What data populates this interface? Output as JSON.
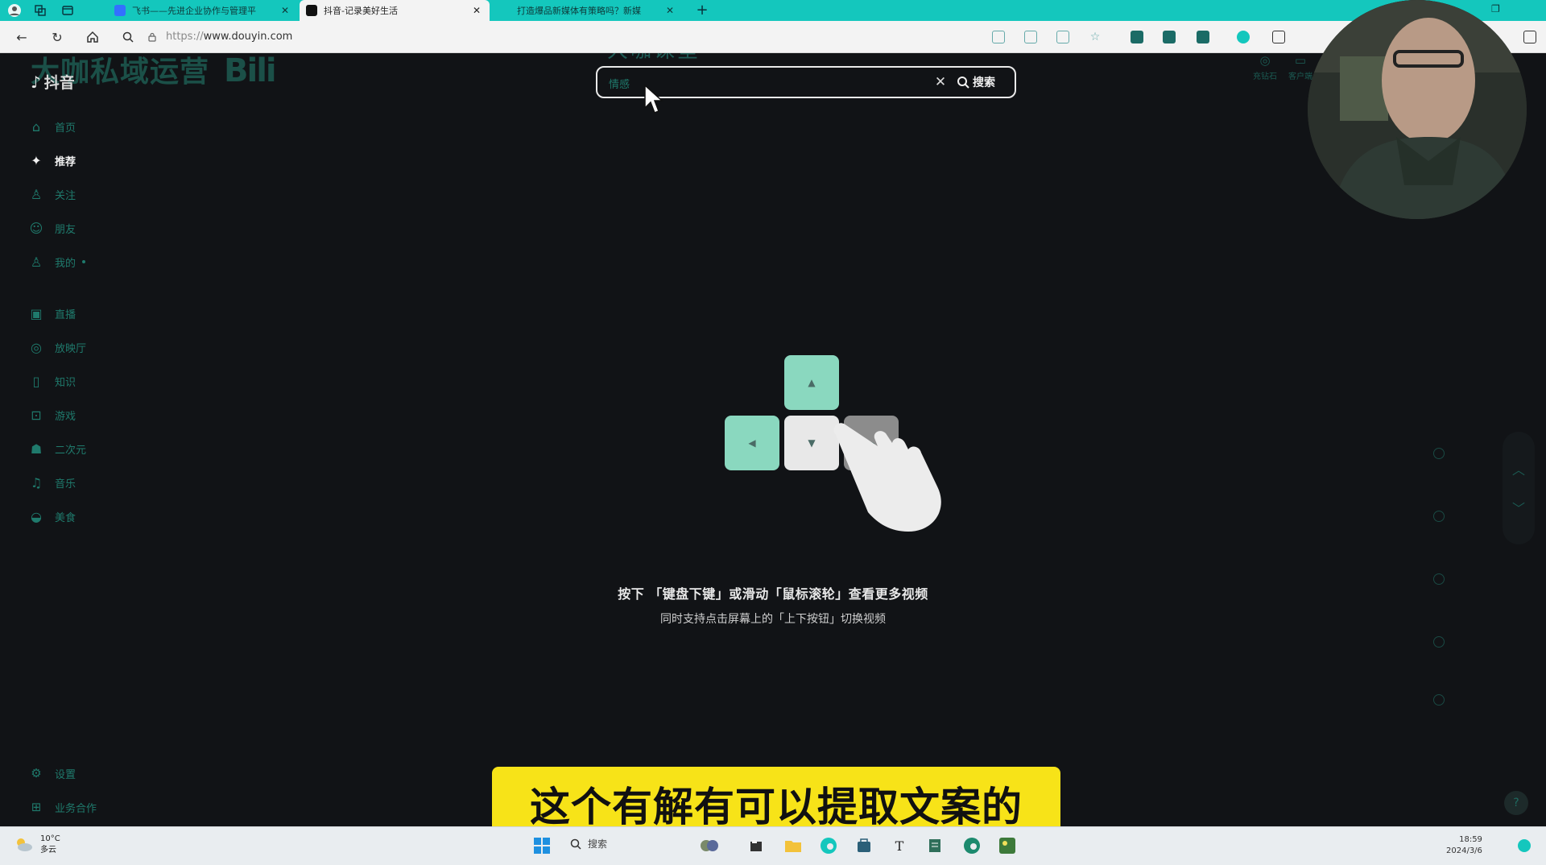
{
  "browser": {
    "tabs": [
      {
        "title": "飞书——先进企业协作与管理平",
        "active": false
      },
      {
        "title": "抖音-记录美好生活",
        "active": true
      },
      {
        "title": "打造爆品新媒体有策略吗？新媒",
        "active": false
      }
    ],
    "url_scheme": "https://",
    "url_host": "www.douyin.com"
  },
  "page": {
    "logo_text": "抖音",
    "overlay_brand": "大咖私域运营",
    "overlay_bili": "Bili",
    "watermark": "大咖课堂",
    "search": {
      "value": "情感",
      "button_label": "搜索"
    },
    "top_right": [
      {
        "label": "充钻石"
      },
      {
        "label": "客户端"
      }
    ],
    "sidebar": {
      "primary": [
        {
          "label": "首页",
          "icon": "home-icon",
          "active": false
        },
        {
          "label": "推荐",
          "icon": "sparkle-icon",
          "active": true
        },
        {
          "label": "关注",
          "icon": "follow-icon",
          "active": false
        },
        {
          "label": "朋友",
          "icon": "friends-icon",
          "active": false
        },
        {
          "label": "我的",
          "icon": "user-icon",
          "active": false,
          "dot": true
        }
      ],
      "secondary": [
        {
          "label": "直播",
          "icon": "live-icon"
        },
        {
          "label": "放映厅",
          "icon": "cinema-icon"
        },
        {
          "label": "知识",
          "icon": "knowledge-icon"
        },
        {
          "label": "游戏",
          "icon": "game-icon"
        },
        {
          "label": "二次元",
          "icon": "anime-icon"
        },
        {
          "label": "音乐",
          "icon": "music-icon"
        },
        {
          "label": "美食",
          "icon": "food-icon"
        }
      ],
      "bottom": [
        {
          "label": "设置",
          "icon": "settings-icon"
        },
        {
          "label": "业务合作",
          "icon": "business-icon"
        }
      ]
    },
    "hint_primary": "按下 「键盘下键」或滑动「鼠标滚轮」查看更多视频",
    "hint_secondary": "同时支持点击屏幕上的「上下按钮」切换视频",
    "subtitle": "这个有解有可以提取文案的"
  },
  "taskbar": {
    "weather_temp": "10°C",
    "weather_desc": "多云",
    "search_label": "搜索",
    "time": "18:59",
    "date": "2024/3/6"
  },
  "colors": {
    "tab_bar": "#14c7bd",
    "page_bg": "#111316",
    "sidebar_text": "#1f7a6c",
    "subtitle_bg": "#f7e318",
    "key_green": "#8ad8bf"
  }
}
